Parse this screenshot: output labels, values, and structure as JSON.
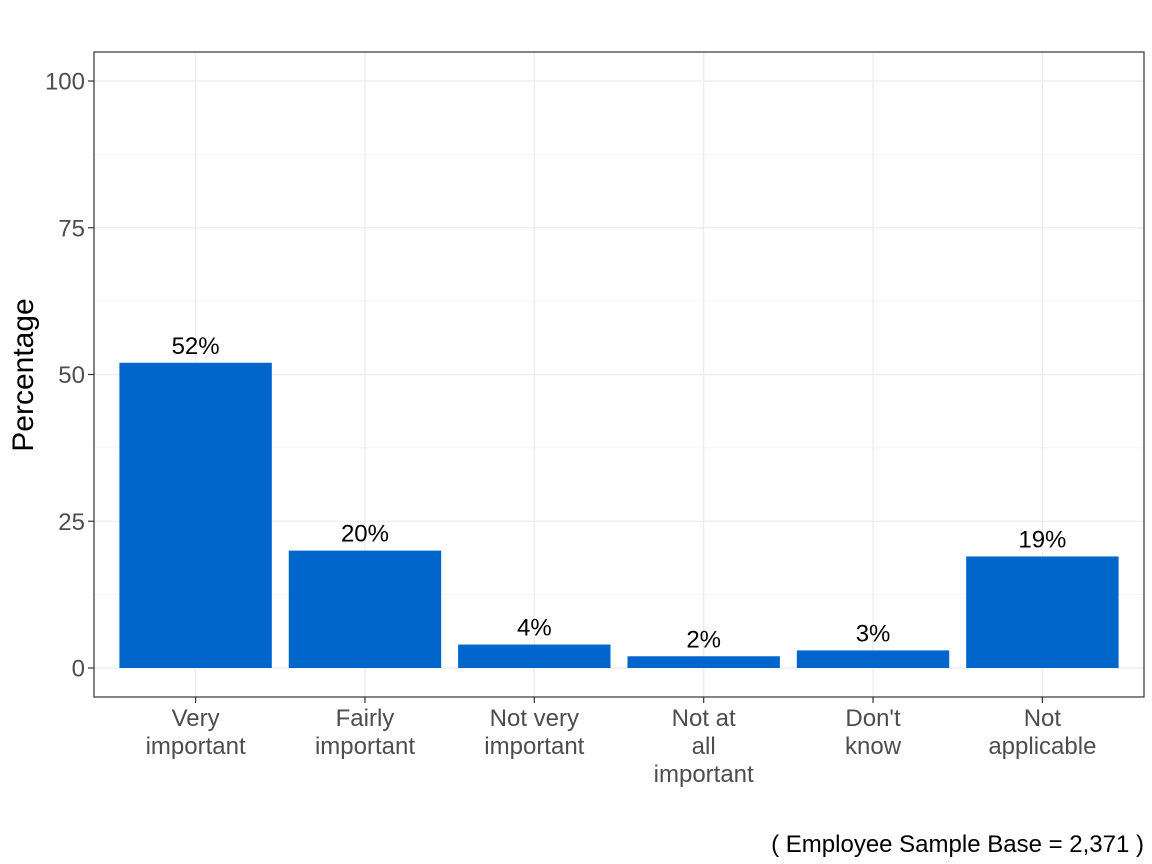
{
  "chart_data": {
    "type": "bar",
    "title": "",
    "xlabel": "",
    "ylabel": "Percentage",
    "ylim": [
      -5,
      105
    ],
    "yticks": [
      0,
      25,
      50,
      75,
      100
    ],
    "grid": true,
    "bar_color": "#0066CC",
    "categories": [
      [
        "Very",
        "important"
      ],
      [
        "Fairly",
        "important"
      ],
      [
        "Not very",
        "important"
      ],
      [
        "Not at",
        "all",
        "important"
      ],
      [
        "Don't",
        "know"
      ],
      [
        "Not",
        "applicable"
      ]
    ],
    "values": [
      52,
      20,
      4,
      2,
      3,
      19
    ],
    "data_labels": [
      "52%",
      "20%",
      "4%",
      "2%",
      "3%",
      "19%"
    ],
    "caption": "( Employee Sample Base =  2,371 )"
  }
}
